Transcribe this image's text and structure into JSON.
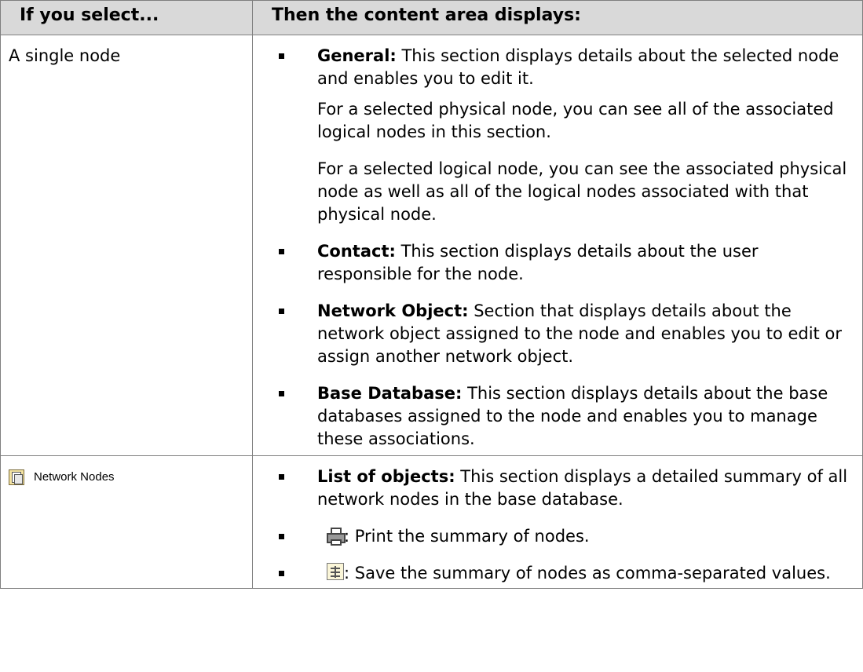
{
  "header": {
    "col1": "If you select...",
    "col2": "Then the content area displays:"
  },
  "rows": [
    {
      "select": "A single node",
      "items": [
        {
          "label": "General:",
          "text": "This section displays details about the selected node and enables you to edit it."
        },
        {
          "text": "For a selected physical node, you can see all of the associated logical nodes in this section."
        },
        {
          "text": "For a selected logical node, you can see the associated physical node as well as all of the logical nodes associated with that physical node."
        },
        {
          "label": "Contact:",
          "text": "This section displays details about the user responsible for the node."
        },
        {
          "label": "Network Object:",
          "text": "Section that displays details about the network object assigned to the node and enables you to edit or assign another network object."
        },
        {
          "label": "Base Database:",
          "text": "This section displays details about the base databases assigned to the node and enables you to manage these associations."
        }
      ]
    },
    {
      "select": "Network Nodes",
      "select_icon": "network-nodes-icon",
      "items": [
        {
          "label": "List of objects:",
          "text": "This section displays a detailed summary of all network nodes in the base database."
        },
        {
          "icon": "printer-icon",
          "text": ": Print the summary of nodes."
        },
        {
          "icon": "csv-export-icon",
          "text": ": Save the summary of nodes as comma-separated values."
        }
      ]
    }
  ]
}
